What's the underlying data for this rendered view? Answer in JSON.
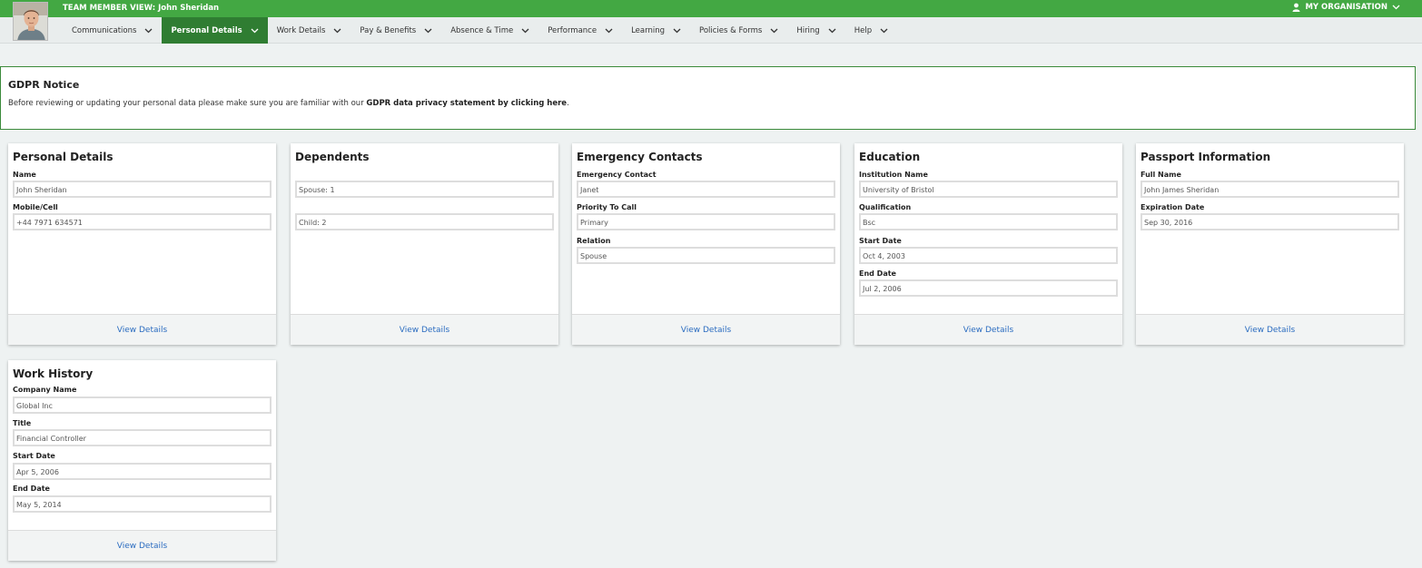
{
  "header": {
    "team_member_view": "TEAM MEMBER VIEW: John Sheridan",
    "my_organisation": "MY ORGANISATION"
  },
  "nav": {
    "items": [
      {
        "label": "Communications"
      },
      {
        "label": "Personal Details",
        "active": true
      },
      {
        "label": "Work Details"
      },
      {
        "label": "Pay & Benefits"
      },
      {
        "label": "Absence & Time"
      },
      {
        "label": "Performance"
      },
      {
        "label": "Learning"
      },
      {
        "label": "Policies & Forms"
      },
      {
        "label": "Hiring"
      },
      {
        "label": "Help"
      }
    ]
  },
  "gdpr": {
    "title": "GDPR Notice",
    "text_prefix": "Before reviewing or updating your personal data please make sure you are familiar with our ",
    "link_text": "GDPR data privacy statement by clicking here",
    "text_suffix": "."
  },
  "cards": {
    "personal_details": {
      "title": "Personal Details",
      "name_label": "Name",
      "name_value": "John Sheridan",
      "mobile_label": "Mobile/Cell",
      "mobile_value": "+44 7971 634571",
      "view_details": "View Details"
    },
    "dependents": {
      "title": "Dependents",
      "spouse_value": "Spouse: 1",
      "child_value": "Child: 2",
      "view_details": "View Details"
    },
    "emergency_contacts": {
      "title": "Emergency Contacts",
      "contact_label": "Emergency Contact",
      "contact_value": "Janet",
      "priority_label": "Priority To Call",
      "priority_value": "Primary",
      "relation_label": "Relation",
      "relation_value": "Spouse",
      "view_details": "View Details"
    },
    "education": {
      "title": "Education",
      "institution_label": "Institution Name",
      "institution_value": "University of Bristol",
      "qualification_label": "Qualification",
      "qualification_value": "Bsc",
      "start_label": "Start Date",
      "start_value": "Oct 4, 2003",
      "end_label": "End Date",
      "end_value": "Jul 2, 2006",
      "view_details": "View Details"
    },
    "passport": {
      "title": "Passport Information",
      "fullname_label": "Full Name",
      "fullname_value": "John James Sheridan",
      "expiration_label": "Expiration Date",
      "expiration_value": "Sep 30, 2016",
      "view_details": "View Details"
    },
    "work_history": {
      "title": "Work History",
      "company_label": "Company Name",
      "company_value": "Global Inc",
      "title_label": "Title",
      "title_value": "Financial Controller",
      "start_label": "Start Date",
      "start_value": "Apr 5, 2006",
      "end_label": "End Date",
      "end_value": "May 5, 2014",
      "view_details": "View Details"
    }
  },
  "colors": {
    "brand_green": "#43a843",
    "active_tab": "#2f7d32",
    "link_blue": "#2b6cc0"
  }
}
